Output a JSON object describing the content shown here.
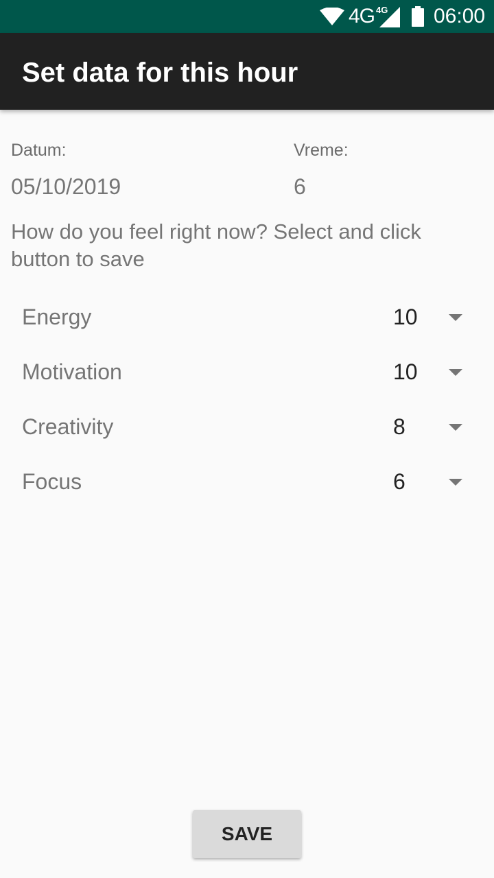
{
  "status_bar": {
    "network": "4G",
    "network_small": "4G",
    "time": "06:00",
    "icons": [
      "wifi-icon",
      "signal-icon",
      "battery-icon"
    ]
  },
  "app_bar": {
    "title": "Set data for this hour"
  },
  "date": {
    "label": "Datum:",
    "value": "05/10/2019"
  },
  "time": {
    "label": "Vreme:",
    "value": "6"
  },
  "instruction": "How do you feel right now? Select and click button to save",
  "metrics": [
    {
      "label": "Energy",
      "value": "10"
    },
    {
      "label": "Motivation",
      "value": "10"
    },
    {
      "label": "Creativity",
      "value": "8"
    },
    {
      "label": "Focus",
      "value": "6"
    }
  ],
  "save_button": {
    "label": "SAVE"
  },
  "colors": {
    "status_bar": "#00574b",
    "app_bar": "#212121",
    "background": "#fafafa",
    "button": "#dadada"
  }
}
